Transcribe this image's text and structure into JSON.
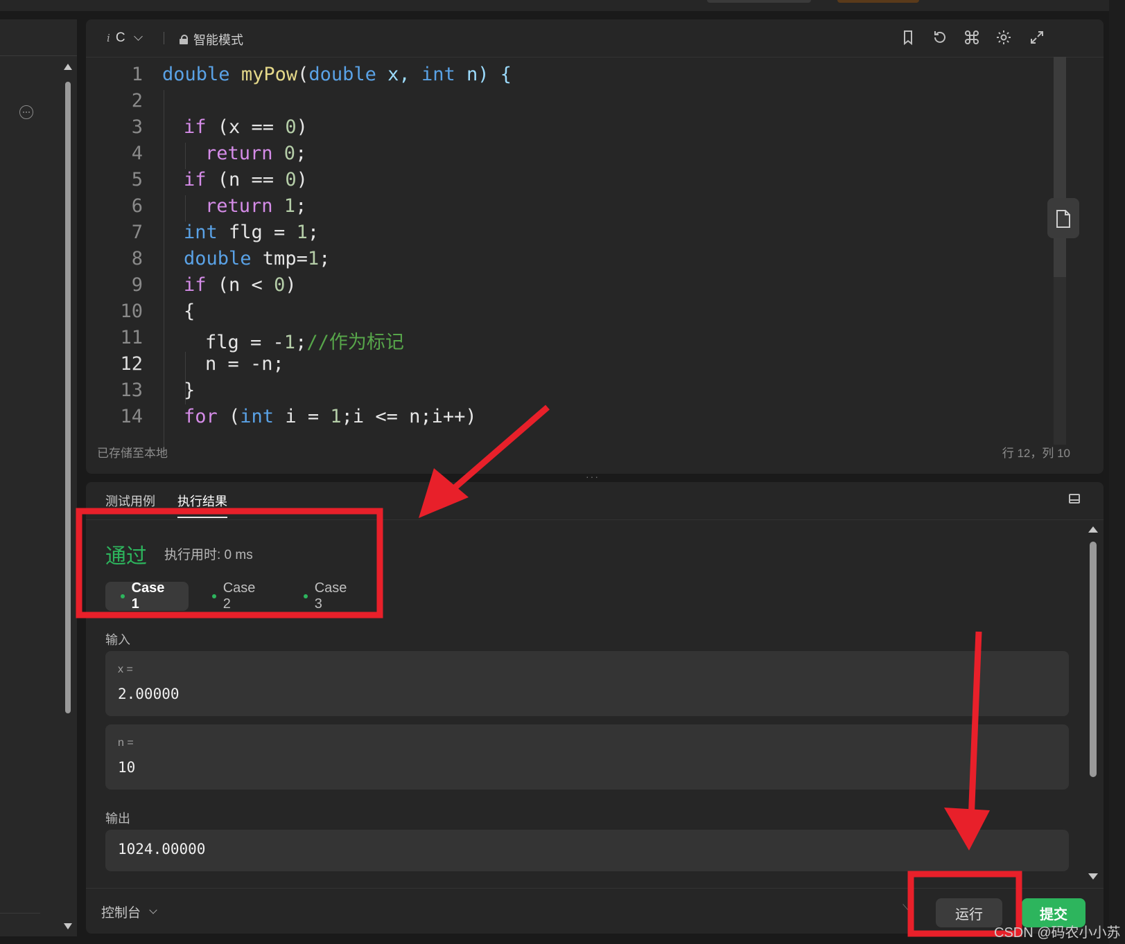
{
  "editor": {
    "language": "C",
    "language_icon": "italic-i-icon",
    "mode": "智能模式",
    "lines": [
      {
        "n": "1"
      },
      {
        "n": "2"
      },
      {
        "n": "3"
      },
      {
        "n": "4"
      },
      {
        "n": "5"
      },
      {
        "n": "6"
      },
      {
        "n": "7"
      },
      {
        "n": "8"
      },
      {
        "n": "9"
      },
      {
        "n": "10"
      },
      {
        "n": "11"
      },
      {
        "n": "12"
      },
      {
        "n": "13"
      },
      {
        "n": "14"
      }
    ],
    "code": {
      "l1": {
        "t1": "double",
        "t2": "myPow",
        "t3": "(",
        "t4": "double",
        "t5": " x, ",
        "t6": "int",
        "t7": " n) {"
      },
      "l3": {
        "t1": "if",
        "t2": " (x == ",
        "t3": "0",
        "t4": ")"
      },
      "l4": {
        "t1": "return",
        "t2": " 0",
        "t3": ";"
      },
      "l5": {
        "t1": "if",
        "t2": " (n == ",
        "t3": "0",
        "t4": ")"
      },
      "l6": {
        "t1": "return",
        "t2": " 1",
        "t3": ";"
      },
      "l7": {
        "t1": "int",
        "t2": " flg = ",
        "t3": "1",
        "t4": ";"
      },
      "l8": {
        "t1": "double",
        "t2": " tmp=",
        "t3": "1",
        "t4": ";"
      },
      "l9": {
        "t1": "if",
        "t2": " (n < ",
        "t3": "0",
        "t4": ")"
      },
      "l10": {
        "t1": "{"
      },
      "l11": {
        "t1": "flg = -",
        "t2": "1",
        "t3": ";",
        "t4": "//作为标记"
      },
      "l12": {
        "t1": "n = -n;"
      },
      "l13": {
        "t1": "}"
      },
      "l14": {
        "t1": "for",
        "t2": " (",
        "t3": "int",
        "t4": " i = ",
        "t5": "1",
        "t6": ";i <= n;i++)"
      }
    },
    "status_saved": "已存储至本地",
    "cursor_position": "行 12，列 10",
    "current_line": "12"
  },
  "result": {
    "tabs": [
      "测试用例",
      "执行结果"
    ],
    "active_tab": "执行结果",
    "status": "通过",
    "runtime": "执行用时: 0 ms",
    "cases": [
      "Case 1",
      "Case 2",
      "Case 3"
    ],
    "active_case": "Case 1",
    "input_label": "输入",
    "inputs": [
      {
        "name": "x =",
        "value": "2.00000"
      },
      {
        "name": "n =",
        "value": "10"
      }
    ],
    "output_label": "输出",
    "output_value": "1024.00000"
  },
  "footer": {
    "console": "控制台",
    "run": "运行",
    "submit": "提交"
  },
  "watermark": "CSDN @码农小小苏",
  "colors": {
    "pass_green": "#2db55d",
    "annotation_red": "#e8202a",
    "keyword_blue": "#5aa2e6",
    "keyword_pink": "#d58ce8"
  }
}
